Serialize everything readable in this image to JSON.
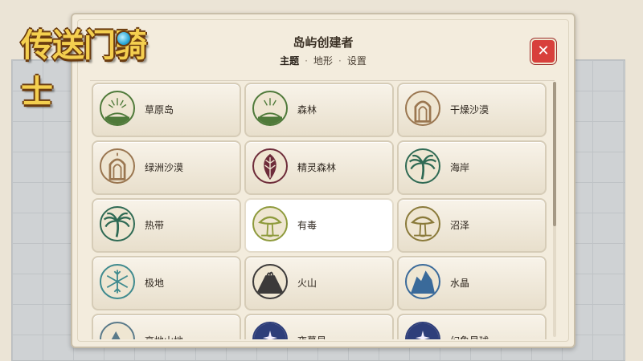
{
  "logo": {
    "text": "传送门骑士"
  },
  "dialog": {
    "title": "岛屿创建者",
    "breadcrumb": [
      {
        "label": "主题",
        "active": true
      },
      {
        "label": "地形",
        "active": false
      },
      {
        "label": "设置",
        "active": false
      }
    ],
    "close_label": "✕"
  },
  "themes": [
    {
      "label": "草原岛",
      "icon": "grassland-icon",
      "color": "#4f7a3a"
    },
    {
      "label": "森林",
      "icon": "forest-icon",
      "color": "#4f7a3a"
    },
    {
      "label": "干燥沙漠",
      "icon": "dry-desert-icon",
      "color": "#9a7650"
    },
    {
      "label": "绿洲沙漠",
      "icon": "oasis-desert-icon",
      "color": "#9a7650"
    },
    {
      "label": "精灵森林",
      "icon": "elf-forest-leaf-icon",
      "color": "#6e2c3a"
    },
    {
      "label": "海岸",
      "icon": "palm-tree-icon",
      "color": "#2f6a54"
    },
    {
      "label": "热带",
      "icon": "tropical-palm-icon",
      "color": "#2f6a54"
    },
    {
      "label": "有毒",
      "icon": "toxic-mushroom-icon",
      "color": "#8e9a3c",
      "selected": true
    },
    {
      "label": "沼泽",
      "icon": "swamp-mushroom-icon",
      "color": "#8a7a3a"
    },
    {
      "label": "极地",
      "icon": "snowflake-icon",
      "color": "#3e8a8e"
    },
    {
      "label": "火山",
      "icon": "volcano-icon",
      "color": "#3c3a3a"
    },
    {
      "label": "水晶",
      "icon": "crystal-icon",
      "color": "#3a6a9a"
    },
    {
      "label": "高地山地",
      "icon": "mountain-icon",
      "color": "#5a7a8a"
    },
    {
      "label": "夜幕星",
      "icon": "night-star-icon",
      "color": "#2e3e7a"
    },
    {
      "label": "幻象星球",
      "icon": "star-planet-icon",
      "color": "#2e3e7a"
    }
  ],
  "colors": {
    "panel_bg": "#f3ecdd",
    "close_red": "#d8403c",
    "logo_gold": "#f4cf4f"
  }
}
